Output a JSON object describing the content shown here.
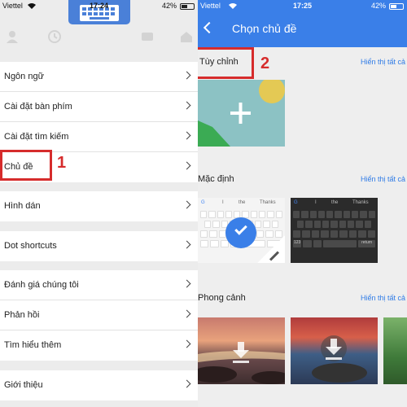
{
  "left": {
    "status": {
      "carrier": "Viettel",
      "time": "17:24",
      "battery": "42%"
    },
    "menu_groups": [
      [
        {
          "label": "Ngôn ngữ"
        },
        {
          "label": "Cài đặt bàn phím"
        },
        {
          "label": "Cài đặt tìm kiếm"
        },
        {
          "label": "Chủ đề"
        }
      ],
      [
        {
          "label": "Hình dán"
        }
      ],
      [
        {
          "label": "Dot shortcuts"
        }
      ],
      [
        {
          "label": "Đánh giá chúng tôi"
        },
        {
          "label": "Phản hồi"
        },
        {
          "label": "Tìm hiểu thêm"
        }
      ],
      [
        {
          "label": "Giới thiệu"
        }
      ]
    ],
    "step_label": "1"
  },
  "right": {
    "status": {
      "carrier": "Viettel",
      "time": "17:25",
      "battery": "42%"
    },
    "title": "Chọn chủ đề",
    "sections": {
      "custom": {
        "title": "Tùy chỉnh",
        "see_all": "Hiển thị tất cả"
      },
      "default": {
        "title": "Mặc định",
        "see_all": "Hiển thị tất cả"
      },
      "landscape": {
        "title": "Phong cảnh",
        "see_all": "Hiển thị tất cả"
      }
    },
    "keyboard_suggestions": {
      "s1": "I",
      "s2": "the",
      "s3": "Thanks"
    },
    "keyboard_keys": {
      "num": "123",
      "ret": "return"
    },
    "step_label": "2"
  },
  "colors": {
    "accent": "#3a7fe8",
    "annotation": "#d62c2c",
    "link": "#2f7be6"
  },
  "icons": [
    "person-icon",
    "clock-icon",
    "keyboard-icon",
    "ticket-icon",
    "home-icon",
    "chevron-right-icon",
    "back-arrow-icon",
    "plus-icon",
    "check-icon",
    "pencil-icon",
    "download-icon",
    "wifi-icon",
    "battery-icon"
  ]
}
